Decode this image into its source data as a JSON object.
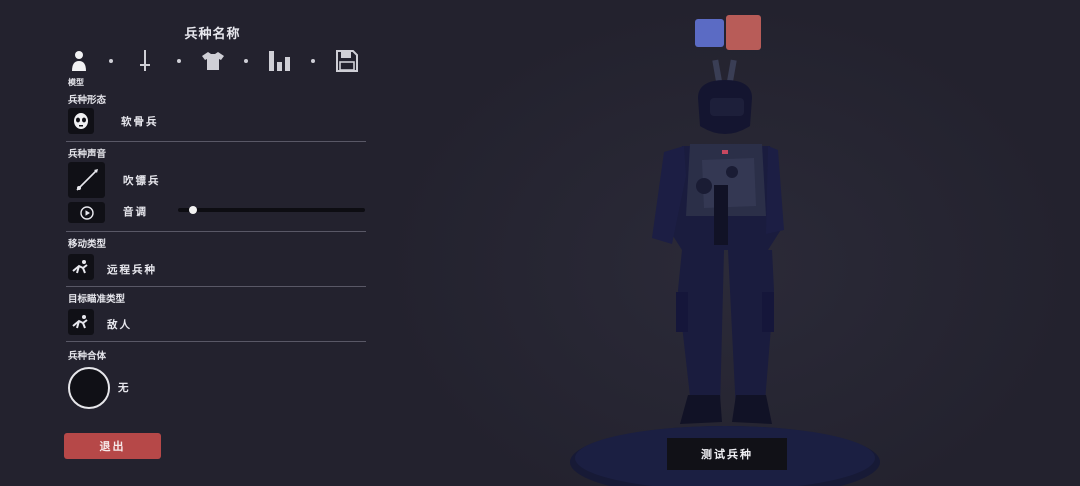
{
  "editor": {
    "title": "兵种名称",
    "tabs": [
      {
        "icon": "person-icon",
        "caption": "模型"
      },
      {
        "icon": "sword-icon"
      },
      {
        "icon": "shirt-icon"
      },
      {
        "icon": "bar-chart-icon"
      },
      {
        "icon": "save-icon"
      }
    ],
    "sections": {
      "form": {
        "label": "兵种形态",
        "value": "软骨兵",
        "icon": "face-mask-icon"
      },
      "sound": {
        "label": "兵种声音",
        "value": "吹镖兵",
        "icon": "blowgun-icon",
        "pitch_label": "音调",
        "pitch_level": 0.06
      },
      "movement": {
        "label": "移动类型",
        "value": "远程兵种",
        "icon": "running-figure-icon"
      },
      "targeting": {
        "label": "目标瞄准类型",
        "value": "敌人",
        "icon": "running-figure-icon"
      },
      "combine": {
        "label": "兵种合体",
        "value": "无"
      }
    },
    "exit_label": "退出"
  },
  "preview": {
    "team_colors": [
      "#5b6bc4",
      "#b85c58"
    ],
    "test_label": "测试兵种"
  }
}
